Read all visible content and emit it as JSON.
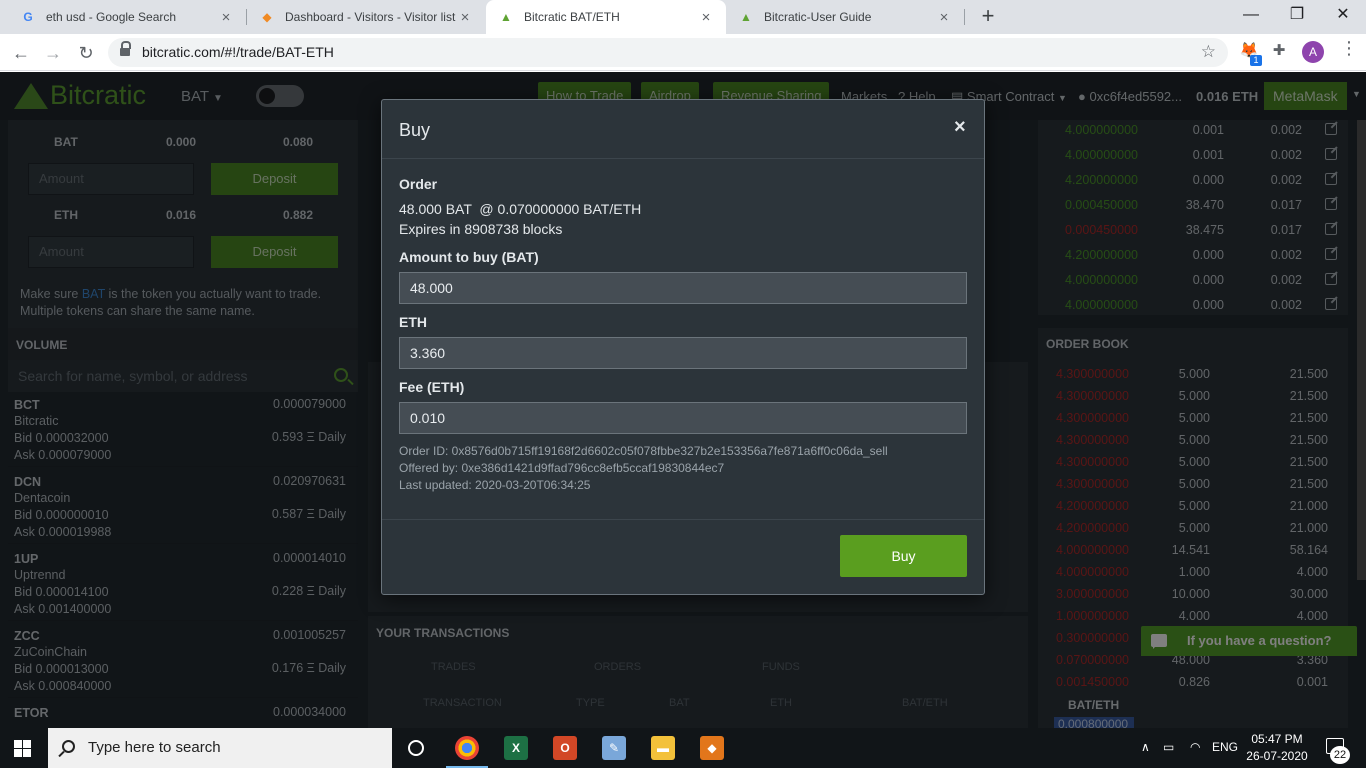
{
  "browser": {
    "tabs": [
      {
        "title": "eth usd - Google Search",
        "icon": "G"
      },
      {
        "title": "Dashboard - Visitors - Visitor list",
        "icon": "◆"
      },
      {
        "title": "Bitcratic BAT/ETH",
        "icon": "▲"
      },
      {
        "title": "Bitcratic-User Guide",
        "icon": "▲"
      }
    ],
    "url": "bitcratic.com/#!/trade/BAT-ETH",
    "extension_badge": "1",
    "profile_initial": "A"
  },
  "app": {
    "brand": "Bitcratic",
    "token": "BAT",
    "nav": {
      "how_to_trade": "How to Trade",
      "airdrop": "Airdrop",
      "revenue_sharing": "Revenue Sharing",
      "markets": "Markets",
      "help": "Help",
      "smart_contract": "Smart Contract",
      "address": "0xc6f4ed5592...",
      "eth_balance": "0.016 ETH",
      "metamask": "MetaMask"
    },
    "balances": {
      "bat": {
        "sym": "BAT",
        "wallet": "0.000",
        "exchange": "0.080"
      },
      "eth": {
        "sym": "ETH",
        "wallet": "0.016",
        "exchange": "0.882"
      },
      "amount_placeholder": "Amount",
      "deposit_label": "Deposit",
      "note_prefix": "Make sure ",
      "note_link": "BAT",
      "note_suffix": " is the token you actually want to trade.",
      "note_line2": "Multiple tokens can share the same name."
    },
    "volume": {
      "title": "VOLUME",
      "search_placeholder": "Search for name, symbol, or address",
      "tokens": [
        {
          "sym": "BCT",
          "name": "Bitcratic",
          "price": "0.000079000",
          "bid": "Bid 0.000032000",
          "ask": "Ask 0.000079000",
          "daily": "0.593 Ξ Daily"
        },
        {
          "sym": "DCN",
          "name": "Dentacoin",
          "price": "0.020970631",
          "bid": "Bid 0.000000010",
          "ask": "Ask 0.000019988",
          "daily": "0.587 Ξ Daily"
        },
        {
          "sym": "1UP",
          "name": "Uptrennd",
          "price": "0.000014010",
          "bid": "Bid 0.000014100",
          "ask": "Ask 0.001400000",
          "daily": "0.228 Ξ Daily"
        },
        {
          "sym": "ZCC",
          "name": "ZuCoinChain",
          "price": "0.001005257",
          "bid": "Bid 0.000013000",
          "ask": "Ask 0.000840000",
          "daily": "0.176 Ξ Daily"
        },
        {
          "sym": "ETOR",
          "name": "",
          "price": "0.000034000",
          "bid": "",
          "ask": "",
          "daily": ""
        }
      ]
    },
    "trades_top": [
      {
        "price": "4.000000000",
        "amt": "0.001",
        "tot": "0.002",
        "c": "g"
      },
      {
        "price": "4.000000000",
        "amt": "0.001",
        "tot": "0.002",
        "c": "g"
      },
      {
        "price": "4.200000000",
        "amt": "0.000",
        "tot": "0.002",
        "c": "g"
      },
      {
        "price": "0.000450000",
        "amt": "38.470",
        "tot": "0.017",
        "c": "g"
      },
      {
        "price": "0.000450000",
        "amt": "38.475",
        "tot": "0.017",
        "c": "r"
      },
      {
        "price": "4.200000000",
        "amt": "0.000",
        "tot": "0.002",
        "c": "g"
      },
      {
        "price": "4.000000000",
        "amt": "0.000",
        "tot": "0.002",
        "c": "g"
      },
      {
        "price": "4.000000000",
        "amt": "0.000",
        "tot": "0.002",
        "c": "g"
      }
    ],
    "order_book": {
      "title": "ORDER BOOK",
      "rows": [
        {
          "price": "4.300000000",
          "amt": "5.000",
          "tot": "21.500"
        },
        {
          "price": "4.300000000",
          "amt": "5.000",
          "tot": "21.500"
        },
        {
          "price": "4.300000000",
          "amt": "5.000",
          "tot": "21.500"
        },
        {
          "price": "4.300000000",
          "amt": "5.000",
          "tot": "21.500"
        },
        {
          "price": "4.300000000",
          "amt": "5.000",
          "tot": "21.500"
        },
        {
          "price": "4.300000000",
          "amt": "5.000",
          "tot": "21.500"
        },
        {
          "price": "4.200000000",
          "amt": "5.000",
          "tot": "21.000"
        },
        {
          "price": "4.200000000",
          "amt": "5.000",
          "tot": "21.000"
        },
        {
          "price": "4.000000000",
          "amt": "14.541",
          "tot": "58.164"
        },
        {
          "price": "4.000000000",
          "amt": "1.000",
          "tot": "4.000"
        },
        {
          "price": "3.000000000",
          "amt": "10.000",
          "tot": "30.000"
        },
        {
          "price": "1.000000000",
          "amt": "4.000",
          "tot": "4.000"
        },
        {
          "price": "0.300000000",
          "amt": "40.000",
          "tot": "12.000"
        },
        {
          "price": "0.070000000",
          "amt": "48.000",
          "tot": "3.360"
        },
        {
          "price": "0.001450000",
          "amt": "0.826",
          "tot": "0.001"
        }
      ],
      "pair": "BAT/ETH",
      "last": "0.000800000"
    },
    "transactions": {
      "title": "YOUR TRANSACTIONS",
      "tabs": [
        "TRADES",
        "ORDERS",
        "FUNDS"
      ],
      "cols": [
        "TRANSACTION",
        "TYPE",
        "BAT",
        "ETH",
        "BAT/ETH"
      ]
    },
    "chat": "If you have a question?"
  },
  "modal": {
    "title": "Buy",
    "close": "×",
    "order_label": "Order",
    "order_line": "48.000 BAT  @ 0.070000000 BAT/ETH",
    "expires": "Expires in 8908738 blocks",
    "amount_label": "Amount to buy  (BAT)",
    "amount_value": "48.000",
    "eth_label": "ETH",
    "eth_value": "3.360",
    "fee_label": "Fee  (ETH)",
    "fee_value": "0.010",
    "order_id": "Order ID: 0x8576d0b715ff19168f2d6602c05f078fbbe327b2e153356a7fe871a6ff0c06da_sell",
    "offered_by": "Offered by: 0xe386d1421d9ffad796cc8efb5ccaf19830844ec7",
    "last_updated": "Last updated: 2020-03-20T06:34:25",
    "buy_button": "Buy"
  },
  "taskbar": {
    "search_placeholder": "Type here to search",
    "lang": "ENG",
    "time": "05:47 PM",
    "date": "26-07-2020",
    "notif_count": "22"
  }
}
